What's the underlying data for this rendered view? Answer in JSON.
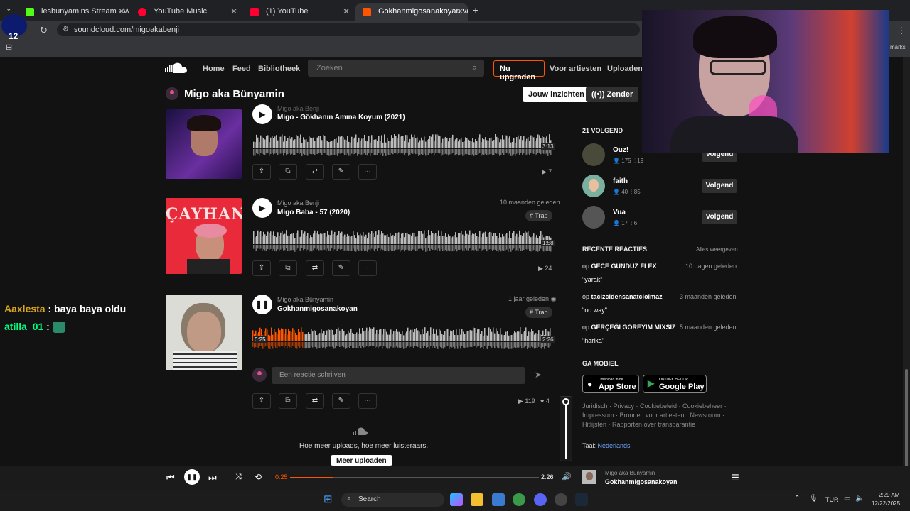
{
  "browser": {
    "tabs": [
      {
        "label": "lesbunyamins Stream - Watch L",
        "color": "#53fc18"
      },
      {
        "label": "YouTube Music",
        "color": "#ff0033"
      },
      {
        "label": "(1) YouTube",
        "color": "#ff0033"
      },
      {
        "label": "Gokhanmigosanakoyan van",
        "color": "#ff5500"
      }
    ],
    "url": "soundcloud.com/migoakabenji",
    "bookmarks_tail": "marks"
  },
  "sc_header": {
    "home": "Home",
    "feed": "Feed",
    "library": "Bibliotheek",
    "search_placeholder": "Zoeken",
    "upgrade": "Nu upgraden",
    "for_artists": "Voor artiesten",
    "upload": "Uploaden"
  },
  "profile": {
    "name": "Migo aka Bünyamin",
    "insights": "Jouw inzichten",
    "station": "Zender"
  },
  "tracks": [
    {
      "artist": "Migo aka Benji",
      "title": "Migo - Gökhanın Amına Koyum (2021)",
      "duration": "3:13",
      "plays": "7",
      "ago": "",
      "tag": ""
    },
    {
      "artist": "Migo aka Benji",
      "title": "Migo Baba - 57 (2020)",
      "duration": "1:58",
      "plays": "24",
      "ago": "10 maanden geleden",
      "tag": "# Trap",
      "art_text": "ÇAYHANE"
    },
    {
      "artist": "Migo aka Bünyamin",
      "title": "Gokhanmigosanakoyan",
      "elapsed": "0:25",
      "duration": "2:26",
      "plays": "119",
      "likes": "4",
      "ago": "1 jaar geleden",
      "tag": "# Trap",
      "progress": 0.17
    }
  ],
  "comment_placeholder": "Een reactie schrijven",
  "more_uploads": {
    "text": "Hoe meer uploads, hoe meer luisteraars.",
    "button": "Meer uploaden"
  },
  "following": {
    "header": "21 VOLGEND",
    "items": [
      {
        "name": "Ouz!",
        "followers": "175",
        "tracks": "19",
        "button": "Volgend"
      },
      {
        "name": "faith",
        "followers": "40",
        "tracks": "85",
        "button": "Volgend"
      },
      {
        "name": "Vua",
        "followers": "17",
        "tracks": "6",
        "button": "Volgend"
      }
    ]
  },
  "recent_comments": {
    "header": "RECENTE REACTIES",
    "view_all": "Alles weergeven",
    "items": [
      {
        "prefix": "op",
        "track": "GECE GÜNDÜZ FLEX",
        "ago": "10 dagen geleden",
        "text": "\"yarak\""
      },
      {
        "prefix": "op",
        "track": "tacizcidensanatciolmaz",
        "ago": "3 maanden geleden",
        "text": "\"no way\""
      },
      {
        "prefix": "op",
        "track": "GERÇEĞİ GÖREYİM MİXSİZ",
        "ago": "5 maanden geleden",
        "text": "\"harika\""
      }
    ]
  },
  "mobile": {
    "header": "GA MOBIEL",
    "appstore_small": "Download in de",
    "appstore": "App Store",
    "google_small": "ONTDEK HET OP",
    "google": "Google Play"
  },
  "footer": {
    "line1": "Juridisch · Privacy · Cookiebeleid · Cookiebeheer ·",
    "line2": "Impressum · Bronnen voor artiesten · Newsroom ·",
    "line3": "Hitlijsten · Rapporten over transparantie",
    "lang_label": "Taal:",
    "lang": "Nederlands"
  },
  "player": {
    "elapsed": "0:25",
    "duration": "2:26",
    "progress": 0.17,
    "artist": "Migo aka Bünyamin",
    "title": "Gokhanmigosanakoyan",
    "volume": 0.95
  },
  "chat": [
    {
      "user": "Aaxlesta",
      "msg": ": baya baya oldu",
      "color": "#daa520"
    },
    {
      "user": "atilla_01",
      "msg": ":",
      "color": "#00ff7f"
    }
  ],
  "taskbar": {
    "search": "Search",
    "lang": "TUR",
    "time": "2:29 AM",
    "date": "12/22/2025"
  },
  "overlay_badge": "12"
}
